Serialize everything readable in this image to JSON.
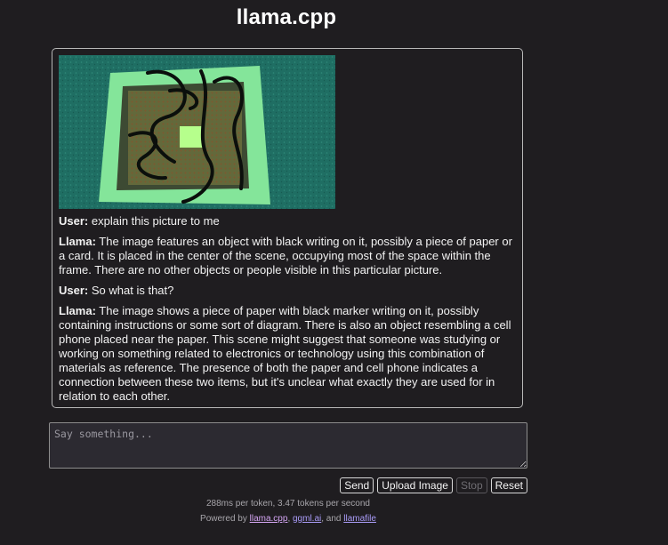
{
  "app": {
    "title": "llama.cpp"
  },
  "chat": {
    "messages": [
      {
        "speaker": "User:",
        "text": "explain this picture to me"
      },
      {
        "speaker": "Llama:",
        "text": "The image features an object with black writing on it, possibly a piece of paper or a card. It is placed in the center of the scene, occupying most of the space within the frame. There are no other objects or people visible in this particular picture."
      },
      {
        "speaker": "User:",
        "text": "So what is that?"
      },
      {
        "speaker": "Llama:",
        "text": "The image shows a piece of paper with black marker writing on it, possibly containing instructions or some sort of diagram. There is also an object resembling a cell phone placed near the paper. This scene might suggest that someone was studying or working on something related to electronics or technology using this combination of materials as reference. The presence of both the paper and cell phone indicates a connection between these two items, but it's unclear what exactly they are used for in relation to each other."
      }
    ]
  },
  "input": {
    "placeholder": "Say something...",
    "value": ""
  },
  "buttons": {
    "send": "Send",
    "upload": "Upload Image",
    "stop": "Stop",
    "reset": "Reset"
  },
  "footer": {
    "stats": "288ms per token, 3.47 tokens per second",
    "powered_prefix": "Powered by",
    "sep1": ",",
    "sep2": ", and",
    "links": [
      "llama.cpp",
      "ggml.ai",
      "llamafile"
    ]
  },
  "colors": {
    "background": "#1f1d20",
    "link": "#a99bf7",
    "visited_link": "#d5a6f4",
    "image_green": "#7bdc8a"
  }
}
